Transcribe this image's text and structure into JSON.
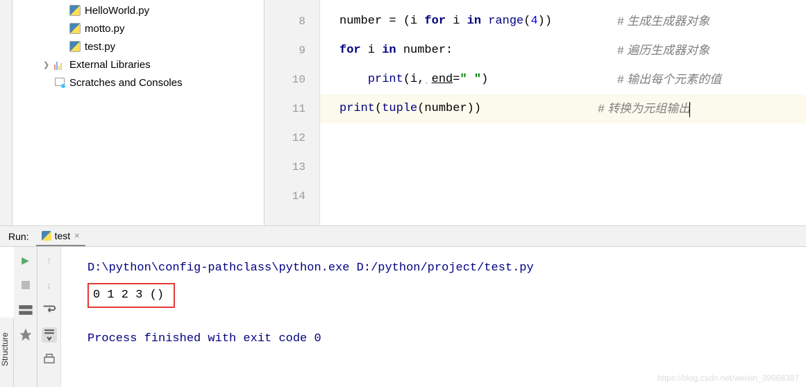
{
  "tree": {
    "files": [
      "HelloWorld.py",
      "motto.py",
      "test.py"
    ],
    "external": "External Libraries",
    "scratch": "Scratches and Consoles"
  },
  "editor": {
    "lines": [
      {
        "num": "8",
        "code_html": "number = (i <span class='kw'>for</span> i <span class='kw'>in</span> <span class='builtin'>range</span>(<span class='num'>4</span>))",
        "comment": "# 生成生成器对象"
      },
      {
        "num": "9",
        "code_html": "<span class='kw'>for</span> i <span class='kw'>in</span> number:",
        "comment": "# 遍历生成器对象"
      },
      {
        "num": "10",
        "code_html": "    <span class='builtin'>print</span>(i,<span style='color:#bbb'>˯</span><span style='text-decoration:underline'>end</span>=<span class='str'>\" \"</span>)",
        "comment": "# 输出每个元素的值"
      },
      {
        "num": "11",
        "code_html": "<span class='builtin'>print</span>(<span class='builtin'>tuple</span>(number))",
        "comment": "# 转换为元组输出",
        "hl": true,
        "cursor": true
      },
      {
        "num": "12",
        "code_html": "",
        "comment": ""
      },
      {
        "num": "13",
        "code_html": "",
        "comment": ""
      },
      {
        "num": "14",
        "code_html": "",
        "comment": ""
      }
    ]
  },
  "run": {
    "label": "Run:",
    "tab_name": "test",
    "cmd": "D:\\python\\config-pathclass\\python.exe D:/python/project/test.py",
    "output": "0 1 2 3 ()",
    "exit": "Process finished with exit code 0"
  },
  "sidebar_label": "Structure",
  "watermark": "https://blog.csdn.net/weixin_39868387"
}
